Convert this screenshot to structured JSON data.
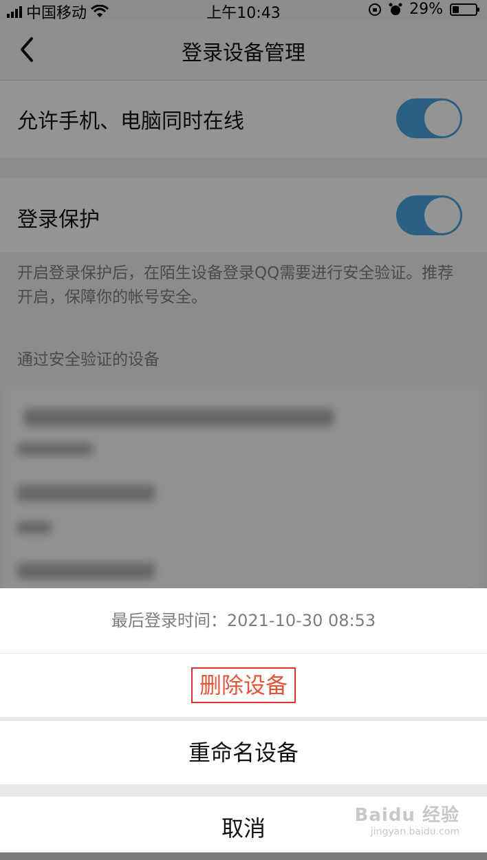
{
  "status_bar": {
    "carrier": "中国移动",
    "time": "上午10:43",
    "battery": "29%",
    "battery_level": 0.29
  },
  "nav": {
    "title": "登录设备管理"
  },
  "settings": {
    "simultaneous_online": {
      "label": "允许手机、电脑同时在线",
      "enabled": true
    },
    "login_protection": {
      "label": "登录保护",
      "enabled": true
    },
    "protection_note": "开启登录保护后，在陌生设备登录QQ需要进行安全验证。推荐开启，保障你的帐号安全。",
    "verified_devices_header": "通过安全验证的设备"
  },
  "action_sheet": {
    "last_login": "最后登录时间：2021-10-30 08:53",
    "delete_label": "删除设备",
    "rename_label": "重命名设备",
    "cancel_label": "取消"
  },
  "watermark": {
    "brand": "Baidu 经验",
    "url": "jingyan.baidu.com"
  },
  "colors": {
    "toggle_on": "#4aa6e0",
    "delete": "#e0563a",
    "highlight_box": "#d9332b"
  }
}
